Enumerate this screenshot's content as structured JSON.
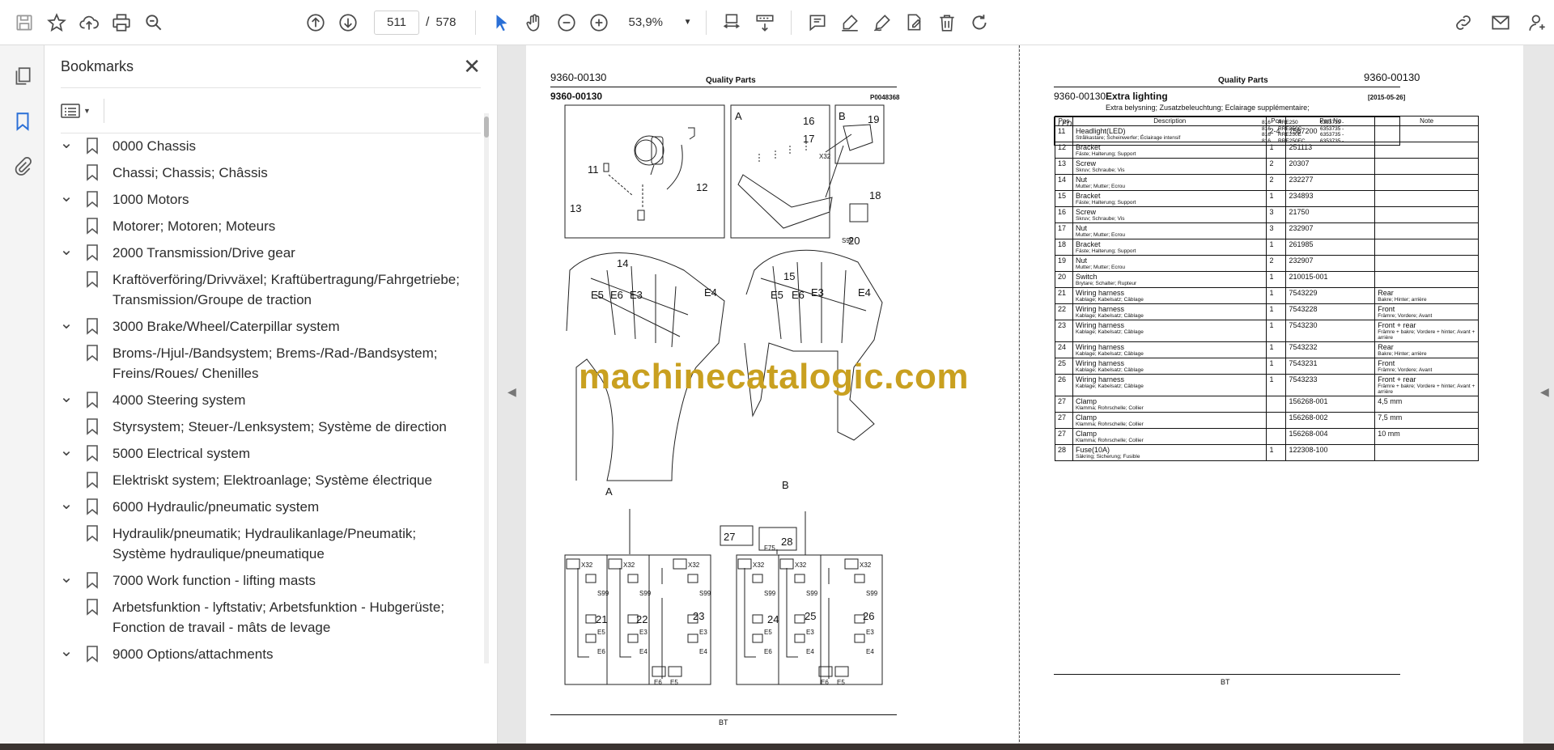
{
  "toolbar": {
    "page_current": "511",
    "page_sep": "/",
    "page_total": "578",
    "zoom": "53,9%"
  },
  "bookmarks_panel": {
    "title": "Bookmarks",
    "items": [
      {
        "label": "0000 Chassis",
        "level": 0
      },
      {
        "label": "Chassi; Chassis; Châssis",
        "level": 1
      },
      {
        "label": "1000 Motors",
        "level": 0
      },
      {
        "label": "Motorer; Motoren; Moteurs",
        "level": 1
      },
      {
        "label": "2000 Transmission/Drive gear",
        "level": 0
      },
      {
        "label": "Kraftöverföring/Drivväxel; Kraftübertragung/Fahrgetriebe; Transmission/Groupe de traction",
        "level": 1
      },
      {
        "label": "3000 Brake/Wheel/Caterpillar system",
        "level": 0
      },
      {
        "label": "Broms-/Hjul-/Bandsystem; Brems-/Rad-/Bandsystem; Freins/Roues/ Chenilles",
        "level": 1
      },
      {
        "label": "4000 Steering system",
        "level": 0
      },
      {
        "label": "Styrsystem; Steuer-/Lenksystem; Système de direction",
        "level": 1
      },
      {
        "label": "5000 Electrical system",
        "level": 0
      },
      {
        "label": "Elektriskt system; Elektroanlage; Système électrique",
        "level": 1
      },
      {
        "label": "6000 Hydraulic/pneumatic system",
        "level": 0
      },
      {
        "label": "Hydraulik/pneumatik; Hydraulikanlage/Pneumatik; Système hydraulique/pneumatique",
        "level": 1
      },
      {
        "label": "7000 Work function - lifting masts",
        "level": 0
      },
      {
        "label": "Arbetsfunktion - lyftstativ; Arbetsfunktion - Hubgerüste; Fonction de travail - mâts de levage",
        "level": 1
      },
      {
        "label": "9000 Options/attachments",
        "level": 0
      }
    ]
  },
  "left_page": {
    "doc_no": "9360-00130",
    "heading": "Quality Parts",
    "doc_no_2": "9360-00130",
    "fig_ref": "P0048368",
    "footer": "BT",
    "labels": [
      "11",
      "12",
      "13",
      "14",
      "15",
      "16",
      "17",
      "18",
      "19",
      "20",
      "21",
      "22",
      "23",
      "24",
      "25",
      "26",
      "27",
      "28",
      "A",
      "B",
      "E3",
      "E4",
      "E5",
      "E6",
      "X32",
      "S99",
      "F75"
    ]
  },
  "watermark": "machinecatalogic.com",
  "right_page": {
    "heading": "Quality Parts",
    "doc_no": "9360-00130",
    "doc_no_2": "9360-00130",
    "title": "Extra lighting",
    "subtitle": "Extra belysning; Zusatzbeleuchtung; Eclairage supplémentaire;",
    "date": "[2015-05-26]",
    "group_label": "LED",
    "models": [
      {
        "num": "816",
        "model": "RRE250",
        "serial": "6353735 -"
      },
      {
        "num": "816",
        "model": "RRE250C",
        "serial": "6353735 -"
      },
      {
        "num": "816",
        "model": "RRE250E",
        "serial": "6353735 -"
      },
      {
        "num": "816",
        "model": "RRE250EC",
        "serial": "6353735 -"
      }
    ],
    "columns": [
      "Pos",
      "Description",
      "Pcs",
      "Part No",
      "Note"
    ],
    "rows": [
      {
        "pos": "11",
        "desc": "Headlight(LED)",
        "sub": "Strålkastare; Scheinwerfer; Éclairage intensif",
        "pcs": "2-4",
        "part": "7567200",
        "note": "",
        "note_sub": ""
      },
      {
        "pos": "12",
        "desc": "Bracket",
        "sub": "Fäste; Halterung; Support",
        "pcs": "1",
        "part": "251113",
        "note": "",
        "note_sub": ""
      },
      {
        "pos": "13",
        "desc": "Screw",
        "sub": "Skruv; Schraube; Vis",
        "pcs": "2",
        "part": "20307",
        "note": "",
        "note_sub": ""
      },
      {
        "pos": "14",
        "desc": "Nut",
        "sub": "Mutter; Mutter; Ecrou",
        "pcs": "2",
        "part": "232277",
        "note": "",
        "note_sub": ""
      },
      {
        "pos": "15",
        "desc": "Bracket",
        "sub": "Fäste; Halterung; Support",
        "pcs": "1",
        "part": "234893",
        "note": "",
        "note_sub": ""
      },
      {
        "pos": "16",
        "desc": "Screw",
        "sub": "Skruv; Schraube; Vis",
        "pcs": "3",
        "part": "21750",
        "note": "",
        "note_sub": ""
      },
      {
        "pos": "17",
        "desc": "Nut",
        "sub": "Mutter; Mutter; Ecrou",
        "pcs": "3",
        "part": "232907",
        "note": "",
        "note_sub": ""
      },
      {
        "pos": "18",
        "desc": "Bracket",
        "sub": "Fäste; Halterung; Support",
        "pcs": "1",
        "part": "261985",
        "note": "",
        "note_sub": ""
      },
      {
        "pos": "19",
        "desc": "Nut",
        "sub": "Mutter; Mutter; Ecrou",
        "pcs": "2",
        "part": "232907",
        "note": "",
        "note_sub": ""
      },
      {
        "pos": "20",
        "desc": "Switch",
        "sub": "Brytare; Schalter; Rupteur",
        "pcs": "1",
        "part": "210015-001",
        "note": "",
        "note_sub": ""
      },
      {
        "pos": "21",
        "desc": "Wiring harness",
        "sub": "Kablage; Kabelsatz; Câblage",
        "pcs": "1",
        "part": "7543229",
        "note": "Rear",
        "note_sub": "Bakre; Hinter; arrière"
      },
      {
        "pos": "22",
        "desc": "Wiring harness",
        "sub": "Kablage; Kabelsatz; Câblage",
        "pcs": "1",
        "part": "7543228",
        "note": "Front",
        "note_sub": "Främre; Vordere; Avant"
      },
      {
        "pos": "23",
        "desc": "Wiring harness",
        "sub": "Kablage; Kabelsatz; Câblage",
        "pcs": "1",
        "part": "7543230",
        "note": "Front + rear",
        "note_sub": "Främre + bakre; Vordere + hinter; Avant + arrière"
      },
      {
        "pos": "24",
        "desc": "Wiring harness",
        "sub": "Kablage; Kabelsatz; Câblage",
        "pcs": "1",
        "part": "7543232",
        "note": "Rear",
        "note_sub": "Bakre; Hinter; arrière"
      },
      {
        "pos": "25",
        "desc": "Wiring harness",
        "sub": "Kablage; Kabelsatz; Câblage",
        "pcs": "1",
        "part": "7543231",
        "note": "Front",
        "note_sub": "Främre; Vordere; Avant"
      },
      {
        "pos": "26",
        "desc": "Wiring harness",
        "sub": "Kablage; Kabelsatz; Câblage",
        "pcs": "1",
        "part": "7543233",
        "note": "Front + rear",
        "note_sub": "Främre + bakre; Vordere + hinter; Avant + arrière"
      },
      {
        "pos": "27",
        "desc": "Clamp",
        "sub": "Klamma; Rohrschelle; Collier",
        "pcs": "",
        "part": "156268-001",
        "note": "4,5 mm",
        "note_sub": ""
      },
      {
        "pos": "27",
        "desc": "Clamp",
        "sub": "Klamma; Rohrschelle; Collier",
        "pcs": "",
        "part": "156268-002",
        "note": "7,5 mm",
        "note_sub": ""
      },
      {
        "pos": "27",
        "desc": "Clamp",
        "sub": "Klamma; Rohrschelle; Collier",
        "pcs": "",
        "part": "156268-004",
        "note": "10 mm",
        "note_sub": ""
      },
      {
        "pos": "28",
        "desc": "Fuse(10A)",
        "sub": "Säkring; Sicherung; Fusible",
        "pcs": "1",
        "part": "122308-100",
        "note": "",
        "note_sub": ""
      }
    ],
    "footer": "BT"
  }
}
